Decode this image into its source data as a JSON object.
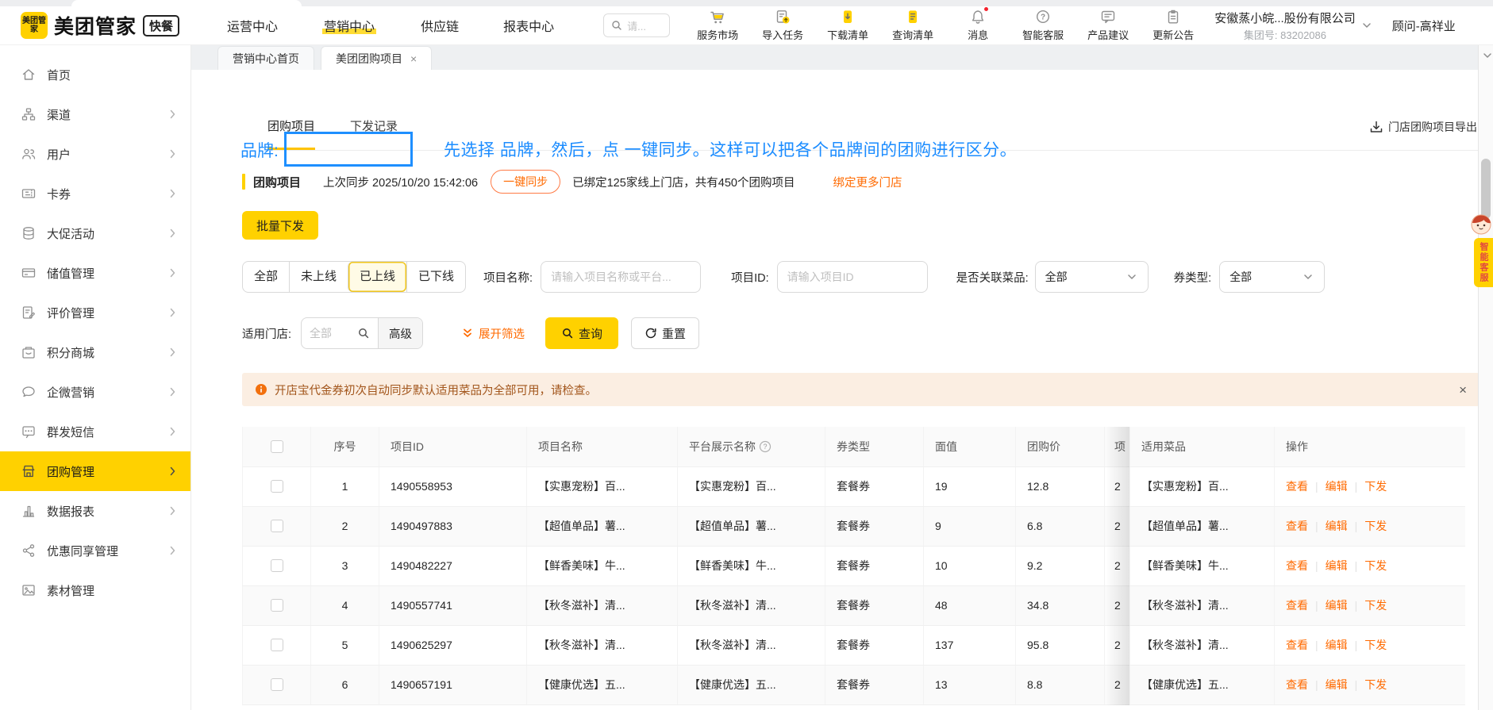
{
  "header": {
    "logo_square": "美团管家",
    "brand": "美团管家",
    "brand_badge": "快餐",
    "nav": [
      {
        "label": "运营中心",
        "active": false
      },
      {
        "label": "营销中心",
        "active": true
      },
      {
        "label": "供应链",
        "active": false
      },
      {
        "label": "报表中心",
        "active": false
      }
    ],
    "search_placeholder": "请...",
    "quick_actions": [
      {
        "label": "服务市场",
        "icon": "market",
        "badge": false
      },
      {
        "label": "导入任务",
        "icon": "import",
        "badge": false
      },
      {
        "label": "下载清单",
        "icon": "download-list",
        "badge": false
      },
      {
        "label": "查询清单",
        "icon": "query-list",
        "badge": false
      },
      {
        "label": "消息",
        "icon": "bell",
        "badge": true
      },
      {
        "label": "智能客服",
        "icon": "help",
        "badge": false
      },
      {
        "label": "产品建议",
        "icon": "suggest",
        "badge": false
      },
      {
        "label": "更新公告",
        "icon": "announce",
        "badge": false
      }
    ],
    "company_name": "安徽蒸小皖...股份有限公司",
    "company_group": "集团号: 83202086",
    "user_name": "顾问-高祥业"
  },
  "window_tabs": [
    {
      "label": "营销中心首页",
      "active": false,
      "closable": false
    },
    {
      "label": "美团团购项目",
      "active": true,
      "closable": true
    }
  ],
  "sidebar": [
    {
      "label": "首页",
      "icon": "home",
      "children": false,
      "active": false
    },
    {
      "label": "渠道",
      "icon": "channel",
      "children": true,
      "active": false
    },
    {
      "label": "用户",
      "icon": "users",
      "children": true,
      "active": false
    },
    {
      "label": "卡券",
      "icon": "coupon",
      "children": true,
      "active": false
    },
    {
      "label": "大促活动",
      "icon": "promo",
      "children": true,
      "active": false
    },
    {
      "label": "储值管理",
      "icon": "stored",
      "children": true,
      "active": false
    },
    {
      "label": "评价管理",
      "icon": "review",
      "children": true,
      "active": false
    },
    {
      "label": "积分商城",
      "icon": "points",
      "children": true,
      "active": false
    },
    {
      "label": "企微营销",
      "icon": "wecom",
      "children": true,
      "active": false
    },
    {
      "label": "群发短信",
      "icon": "sms",
      "children": true,
      "active": false
    },
    {
      "label": "团购管理",
      "icon": "groupbuy",
      "children": true,
      "active": true
    },
    {
      "label": "数据报表",
      "icon": "report",
      "children": true,
      "active": false
    },
    {
      "label": "优惠同享管理",
      "icon": "share",
      "children": true,
      "active": false
    },
    {
      "label": "素材管理",
      "icon": "material",
      "children": false,
      "active": false
    }
  ],
  "page": {
    "inner_tabs": [
      {
        "label": "团购项目",
        "active": true
      },
      {
        "label": "下发记录",
        "active": false
      }
    ],
    "export_link": "门店团购项目导出",
    "annotation": {
      "brand_label": "品牌:",
      "note": "先选择 品牌，然后，点 一键同步。这样可以把各个品牌间的团购进行区分。"
    },
    "sync": {
      "title": "团购项目",
      "last_sync": "上次同步 2025/10/20 15:42:06",
      "sync_button": "一键同步",
      "summary": "已绑定125家线上门店，共有450个团购项目",
      "bind_more": "绑定更多门店"
    },
    "batch_button": "批量下发",
    "filters": {
      "status_tabs": [
        {
          "label": "全部",
          "active": false
        },
        {
          "label": "未上线",
          "active": false
        },
        {
          "label": "已上线",
          "active": true
        },
        {
          "label": "已下线",
          "active": false
        }
      ],
      "name_label": "项目名称:",
      "name_placeholder": "请输入项目名称或平台...",
      "id_label": "项目ID:",
      "id_placeholder": "请输入项目ID",
      "dish_label": "是否关联菜品:",
      "dish_value": "全部",
      "coupon_label": "券类型:",
      "coupon_value": "全部",
      "store_label": "适用门店:",
      "store_placeholder": "全部",
      "advanced_label": "高级",
      "expand_label": "展开筛选",
      "search_label": "查询",
      "reset_label": "重置"
    },
    "notice": "开店宝代金券初次自动同步默认适用菜品为全部可用，请检查。",
    "table": {
      "columns": [
        "序号",
        "项目ID",
        "项目名称",
        "平台展示名称",
        "券类型",
        "面值",
        "团购价",
        "项",
        "适用菜品",
        "操作"
      ],
      "actions": [
        "查看",
        "编辑",
        "下发"
      ],
      "rows": [
        {
          "no": "1",
          "id": "1490558953",
          "name": "【实惠宠粉】百...",
          "platform_name": "【实惠宠粉】百...",
          "coupon_type": "套餐券",
          "face_value": "19",
          "group_price": "12.8",
          "clipped": "2",
          "dishes": "【实惠宠粉】百..."
        },
        {
          "no": "2",
          "id": "1490497883",
          "name": "【超值单品】薯...",
          "platform_name": "【超值单品】薯...",
          "coupon_type": "套餐券",
          "face_value": "9",
          "group_price": "6.8",
          "clipped": "2",
          "dishes": "【超值单品】薯..."
        },
        {
          "no": "3",
          "id": "1490482227",
          "name": "【鲜香美味】牛...",
          "platform_name": "【鲜香美味】牛...",
          "coupon_type": "套餐券",
          "face_value": "10",
          "group_price": "9.2",
          "clipped": "2",
          "dishes": "【鲜香美味】牛..."
        },
        {
          "no": "4",
          "id": "1490557741",
          "name": "【秋冬滋补】清...",
          "platform_name": "【秋冬滋补】清...",
          "coupon_type": "套餐券",
          "face_value": "48",
          "group_price": "34.8",
          "clipped": "2",
          "dishes": "【秋冬滋补】清..."
        },
        {
          "no": "5",
          "id": "1490625297",
          "name": "【秋冬滋补】清...",
          "platform_name": "【秋冬滋补】清...",
          "coupon_type": "套餐券",
          "face_value": "137",
          "group_price": "95.8",
          "clipped": "2",
          "dishes": "【秋冬滋补】清..."
        },
        {
          "no": "6",
          "id": "1490657191",
          "name": "【健康优选】五...",
          "platform_name": "【健康优选】五...",
          "coupon_type": "套餐券",
          "face_value": "13",
          "group_price": "8.8",
          "clipped": "2",
          "dishes": "【健康优选】五..."
        }
      ]
    },
    "assistant_widget": "智能客服"
  },
  "colors": {
    "brand_yellow": "#FFD100",
    "accent_orange": "#FF6A00",
    "annotation_blue": "#1B8CFF",
    "notice_bg": "#FBEEE2"
  }
}
